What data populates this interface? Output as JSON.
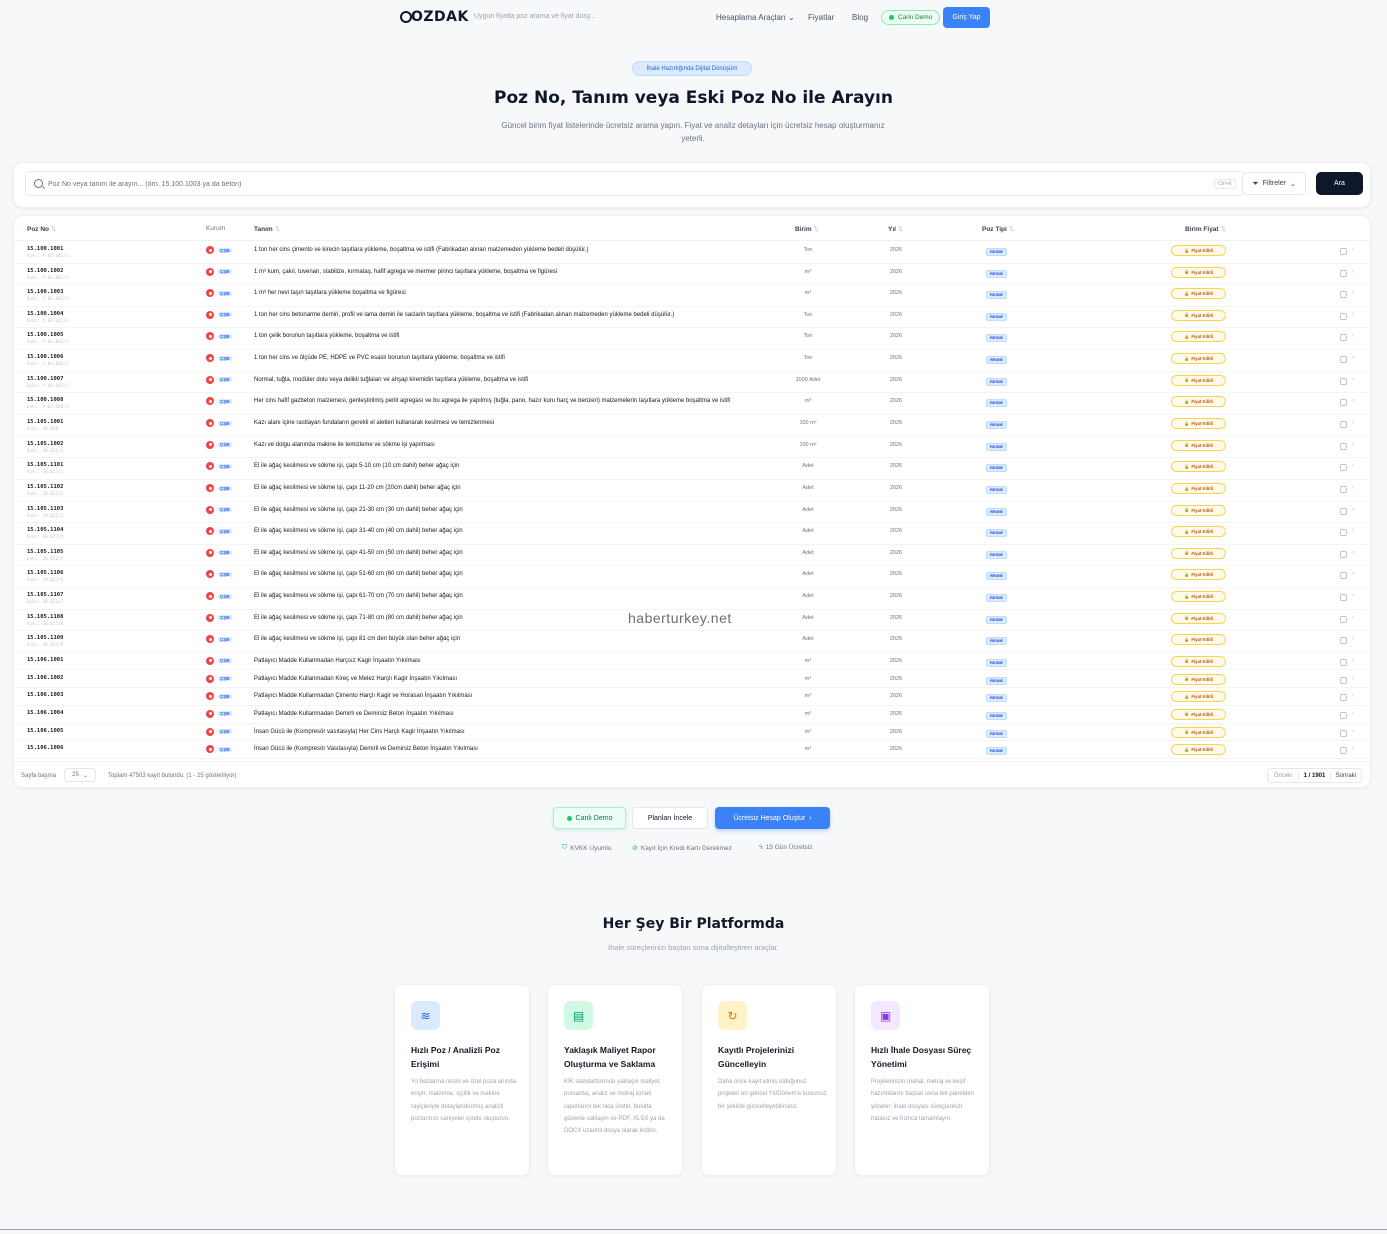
{
  "nav": {
    "logo": "OZDAK",
    "tagline": "Uygun fiyatla poz arama ve fiyat dosy...",
    "links": [
      "Hesaplama Araçları",
      "Fiyatlar",
      "Blog"
    ],
    "live_demo": "Canlı Demo",
    "login": "Giriş Yap"
  },
  "hero": {
    "badge": "İhale Hazırlığında Dijital Dönüşüm",
    "title": "Poz No, Tanım veya Eski Poz No ile Arayın",
    "subtitle": "Güncel birim fiyat listelerinde ücretsiz arama yapın. Fiyat ve analiz detayları için ücretsiz hesap oluşturmanız yeterli."
  },
  "search": {
    "placeholder": "Poz No veya tanım ile arayın... (örn. 15.100.1003 ya da beton)",
    "shortcut": "Ctrl+K",
    "filters": "Filtreler",
    "button": "Ara"
  },
  "table": {
    "headers": {
      "poz_no": "Poz No",
      "kurum": "Kurum",
      "tanim": "Tanım",
      "birim": "Birim",
      "yil": "Yıl",
      "poz_tipi": "Poz Tipi",
      "birim_fiyat": "Birim Fiyat"
    },
    "kurum_label": "ÇŞB",
    "type_label": "RESMİ",
    "price_label": "Fiyat Kilitli",
    "rows": [
      {
        "code": "15.100.1001",
        "old": "Eski: Y.03.001/1",
        "desc": "1 ton her cins çimento ve kirecin taşıtlara yükleme, boşaltma ve istifi (Fabrikadan alınan malzemeden yükleme bedeli düşülür.)",
        "unit": "Ton",
        "year": "2026"
      },
      {
        "code": "15.100.1002",
        "old": "Eski: Y.03.002/1",
        "desc": "1 m³ kum, çakıl, tuvenan, stabilize, kırmataş, hafif agrega ve mermer pirinci taşıtlara yükleme, boşaltma ve figüresi",
        "unit": "m³",
        "year": "2026"
      },
      {
        "code": "15.100.1003",
        "old": "Eski: Y.03.003/1",
        "desc": "1 m³ her nevi taşın taşıtlara yükleme boşaltma ve figüresi",
        "unit": "m³",
        "year": "2026"
      },
      {
        "code": "15.100.1004",
        "old": "Eski: Y.03.012/1",
        "desc": "1 ton her cins betonarme demiri, profil ve lama demiri ile saclarin taşıtlara yükleme, boşaltma ve istifi (Fabrikadan alınan malzemeden yükleme bedeli düşülür.)",
        "unit": "Ton",
        "year": "2026"
      },
      {
        "code": "15.100.1005",
        "old": "Eski: Y.03.014/1",
        "desc": "1 ton çelik borunun taşıtlara yükleme, boşaltma ve istifi",
        "unit": "Ton",
        "year": "2026"
      },
      {
        "code": "15.100.1006",
        "old": "Eski: Y.03.016/1",
        "desc": "1 ton her cins ve ölçüde PE, HDPE ve PVC esaslı borunun taşıtlara yükleme, boşaltma ve istifi",
        "unit": "Ton",
        "year": "2026"
      },
      {
        "code": "15.100.1007",
        "old": "Eski: Y.03.017/1",
        "desc": "Normal, tuğla, modüler dolu veya delikli tuğlaları ve ahşap kiremidin taşıtlara yükleme, boşaltma ve istifi",
        "unit": "1000 Adet",
        "year": "2026"
      },
      {
        "code": "15.100.1008",
        "old": "Eski: Y.03.018/1",
        "desc": "Her cins hafif gazbeton malzemesi, genleştirilmiş perlit agregası ve bu agrega ile yapılmış (tuğla, pano, hazır kuru harç ve benzeri) malzemelerin taşıtlara yükleme boşaltma ve istifi",
        "unit": "m³",
        "year": "2026"
      },
      {
        "code": "15.105.1001",
        "old": "Eski: 20.020",
        "desc": "Kazı alanı içine rastlayan fundaların gerekli el aletleri kullanarak kesilmesi ve temizlenmesi",
        "unit": "100 m²",
        "year": "2026"
      },
      {
        "code": "15.105.1002",
        "old": "Eski: 20.021/1",
        "desc": "Kazı ve dolgu alanında makine ile temizleme ve sökme işi yapılması",
        "unit": "100 m²",
        "year": "2026"
      },
      {
        "code": "15.105.1101",
        "old": "Eski: 20.022/1",
        "desc": "El ile ağaç kesilmesi ve sökme işi, çapı 5-10 cm (10 cm dahil) beher ağaç için",
        "unit": "Adet",
        "year": "2026"
      },
      {
        "code": "15.105.1102",
        "old": "Eski: 20.022/2",
        "desc": "El ile ağaç kesilmesi ve sökme işi, çapı 11-20 cm (20cm dahil) beher ağaç için",
        "unit": "Adet",
        "year": "2026"
      },
      {
        "code": "15.105.1103",
        "old": "Eski: 20.022/3",
        "desc": "El ile ağaç kesilmesi ve sökme işi, çapı 21-30 cm (30 cm dahil) beher ağaç için",
        "unit": "Adet",
        "year": "2026"
      },
      {
        "code": "15.105.1104",
        "old": "Eski: 20.022/4",
        "desc": "El ile ağaç kesilmesi ve sökme işi, çapı 31-40 cm (40 cm dahil) beher ağaç için",
        "unit": "Adet",
        "year": "2026"
      },
      {
        "code": "15.105.1105",
        "old": "Eski: 20.022/5",
        "desc": "El ile ağaç kesilmesi ve sökme işi, çapı 41-50 cm (50 cm dahil) beher ağaç için",
        "unit": "Adet",
        "year": "2026"
      },
      {
        "code": "15.105.1106",
        "old": "Eski: 20.022/6",
        "desc": "El ile ağaç kesilmesi ve sökme işi, çapı 51-60 cm (60 cm dahil) beher ağaç için",
        "unit": "Adet",
        "year": "2026"
      },
      {
        "code": "15.105.1107",
        "old": "Eski: 20.022/7",
        "desc": "El ile ağaç kesilmesi ve sökme işi, çapı 61-70 cm (70 cm dahil) beher ağaç için",
        "unit": "Adet",
        "year": "2026"
      },
      {
        "code": "15.105.1108",
        "old": "Eski: 20.022/8",
        "desc": "El ile ağaç kesilmesi ve sökme işi, çapı 71-80 cm (80 cm dahil) beher ağaç için",
        "unit": "Adet",
        "year": "2026"
      },
      {
        "code": "15.105.1109",
        "old": "Eski: 20.022/9",
        "desc": "El ile ağaç kesilmesi ve sökme işi, çapı 81 cm den büyük olan beher ağaç için",
        "unit": "Adet",
        "year": "2026"
      },
      {
        "code": "15.106.1001",
        "old": "",
        "desc": "Patlayıcı Madde Kullanmadan Harçsız Kagir İnşaatın Yıkılması",
        "unit": "m³",
        "year": "2026"
      },
      {
        "code": "15.106.1002",
        "old": "",
        "desc": "Patlayıcı Madde Kullanmadan Kireç ve Melez Harçlı Kagir İnşaatın Yıkılması",
        "unit": "m³",
        "year": "2026"
      },
      {
        "code": "15.106.1003",
        "old": "",
        "desc": "Patlayıcı Madde Kullanmadan Çimento Harçlı Kagir ve Horasan İnşaatın Yıkılması",
        "unit": "m³",
        "year": "2026"
      },
      {
        "code": "15.106.1004",
        "old": "",
        "desc": "Patlayıcı Madde Kullanmadan Demirli ve Demirsiz Beton İnşaatın Yıkılması",
        "unit": "m³",
        "year": "2026"
      },
      {
        "code": "15.106.1005",
        "old": "",
        "desc": "İnsan Gücü ile (Kompresör vasıtasıyla) Her Cins Harçlı Kagir İnşaatın Yıkılması",
        "unit": "m³",
        "year": "2026"
      },
      {
        "code": "15.106.1006",
        "old": "",
        "desc": "İnsan Gücü ile (Kompresör Vasıtasıyla) Demirli ve Demirsiz Beton İnşaatın Yıkılması",
        "unit": "m³",
        "year": "2026"
      }
    ],
    "footer": {
      "page_size_label": "Sayfa başına",
      "page_size": "25",
      "total": "Toplam 47503 kayıt bulundu. (1 - 25 gösteriliyor)",
      "prev": "Önceki",
      "page": "1 / 1901",
      "next": "Sonraki"
    }
  },
  "cta": {
    "demo": "Canlı Demo",
    "plans": "Planları İncele",
    "signup": "Ücretsiz Hesap Oluştur",
    "trust": [
      "KVKK Uyumlu",
      "Kayıt İçin Kredi Kartı Gerekmez",
      "15 Gün Ücretsiz"
    ]
  },
  "features": {
    "title": "Her Şey Bir Platformda",
    "subtitle": "İhale süreçlerinizi baştan sona dijitalleştiren araçlar.",
    "cards": [
      {
        "icon": "layers-icon",
        "color": "#dbeafe",
        "title": "Hızlı Poz / Analizli Poz Erişimi",
        "text": "Yıl bazlarına resmi ve özel poza anında erişin; malzeme, işçilik ve makine rayiçleriyle detaylandırılmış analizli pozlarınızı saniyeler içinde oluşturun."
      },
      {
        "icon": "spreadsheet-icon",
        "color": "#d1fae5",
        "title": "Yaklaşık Maliyet Rapor Oluşturma ve Saklama",
        "text": "KİK standartlarında yaklaşık maliyet, pursantaj, analiz ve metraj icmali raporlarını tek tıkla üretin, bulutta güvenle saklayın ve PDF, XLSX ya da DOCX uzantılı dosya olarak indirin."
      },
      {
        "icon": "refresh-icon",
        "color": "#fef3c7",
        "title": "Kayıtlı Projelerinizi Güncelleyin",
        "text": "Daha önce kayıt etmiş olduğunuz projeleri en güncel Yıl/Dönem'e kusursuz bir şekilde güncelleyebilirsiniz."
      },
      {
        "icon": "file-tender-icon",
        "color": "#f3e8ff",
        "title": "Hızlı İhale Dosyası Süreç Yönetimi",
        "text": "Projelerinizin mahal, metraj ve keşif hazırlıklarını baştan sona tek panelden yönetin; ihale dosyası süreçlerinizi hatasız ve hızlıca tamamlayın."
      }
    ]
  },
  "watermark": "haberturkey.net"
}
